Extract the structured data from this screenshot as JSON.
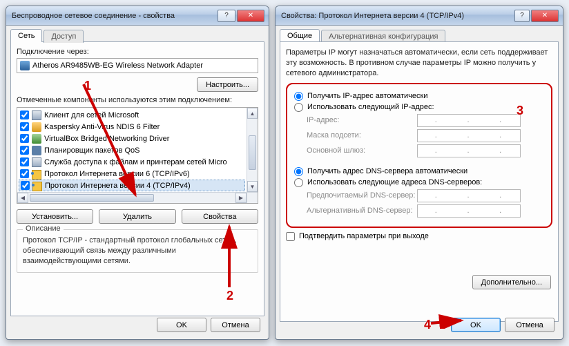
{
  "left": {
    "title": "Беспроводное сетевое соединение - свойства",
    "tabs": {
      "network": "Сеть",
      "access": "Доступ"
    },
    "connect_via": "Подключение через:",
    "adapter": "Atheros AR9485WB-EG Wireless Network Adapter",
    "configure": "Настроить...",
    "components_label": "Отмеченные компоненты используются этим подключением:",
    "components": [
      "Клиент для сетей Microsoft",
      "Kaspersky Anti-Virus NDIS 6 Filter",
      "VirtualBox Bridged Networking Driver",
      "Планировщик пакетов QoS",
      "Служба доступа к файлам и принтерам сетей Micro",
      "Протокол Интернета версии 6 (TCP/IPv6)",
      "Протокол Интернета версии 4 (TCP/IPv4)"
    ],
    "install": "Установить...",
    "uninstall": "Удалить",
    "properties": "Свойства",
    "desc_title": "Описание",
    "desc_text": "Протокол TCP/IP - стандартный протокол глобальных сетей, обеспечивающий связь между различными взаимодействующими сетями.",
    "ok": "OK",
    "cancel": "Отмена"
  },
  "right": {
    "title": "Свойства: Протокол Интернета версии 4 (TCP/IPv4)",
    "tabs": {
      "general": "Общие",
      "alt": "Альтернативная конфигурация"
    },
    "info": "Параметры IP могут назначаться автоматически, если сеть поддерживает эту возможность. В противном случае параметры IP можно получить у сетевого администратора.",
    "ip_auto": "Получить IP-адрес автоматически",
    "ip_manual": "Использовать следующий IP-адрес:",
    "ip_addr": "IP-адрес:",
    "mask": "Маска подсети:",
    "gateway": "Основной шлюз:",
    "dns_auto": "Получить адрес DNS-сервера автоматически",
    "dns_manual": "Использовать следующие адреса DNS-серверов:",
    "dns_pref": "Предпочитаемый DNS-сервер:",
    "dns_alt": "Альтернативный DNS-сервер:",
    "validate": "Подтвердить параметры при выходе",
    "advanced": "Дополнительно...",
    "ok": "OK",
    "cancel": "Отмена"
  },
  "ann": {
    "n1": "1",
    "n2": "2",
    "n3": "3",
    "n4": "4"
  }
}
